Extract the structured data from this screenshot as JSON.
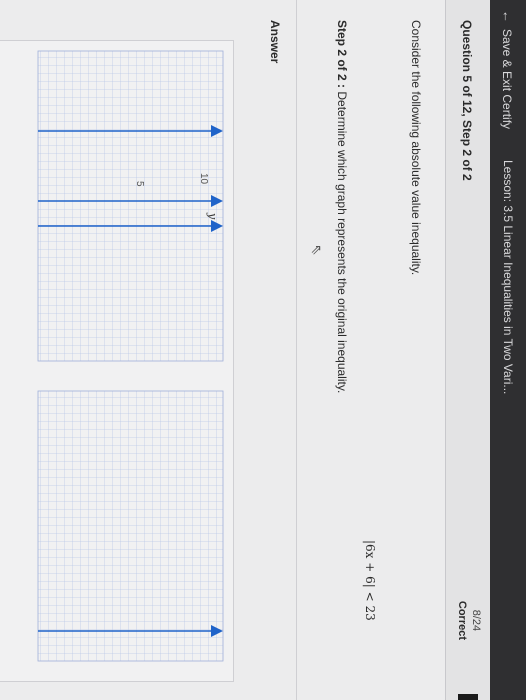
{
  "header": {
    "back_label": "Save & Exit Certify",
    "lesson_title": "Lesson: 3.5 Linear Inequalities in Two Vari..."
  },
  "question": {
    "number_label": "Question 5 of 12, Step 2 of 2",
    "score_fraction": "8/24",
    "score_label": "Correct"
  },
  "problem": {
    "prompt": "Consider the following absolute value inequality.",
    "inequality": "|6x + 6| < 23",
    "step_bold": "Step 2 of 2 :",
    "step_text": " Determine which graph represents the original inequality.",
    "answer_label": "Answer"
  },
  "graph_labels": {
    "y_axis_label": "y",
    "tick_10": "10",
    "tick_5": "5"
  },
  "colors": {
    "line": "#1f63c9",
    "grid": "#b8c6e6",
    "topbar": "#2f2f31"
  },
  "icons": [
    "back-arrow-icon",
    "pointer-cursor-icon"
  ]
}
